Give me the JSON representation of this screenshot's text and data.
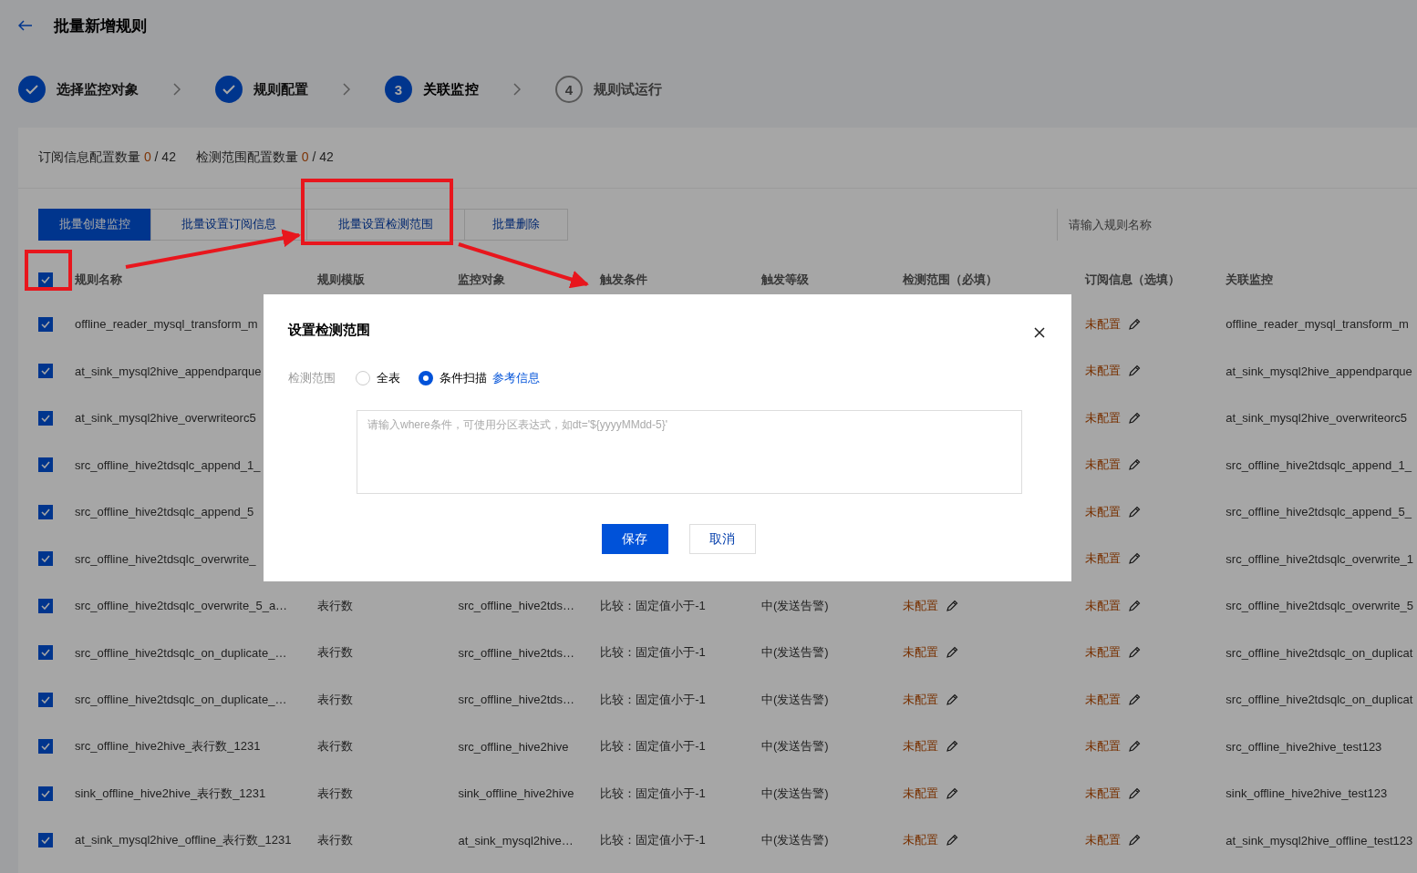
{
  "page": {
    "title": "批量新增规则"
  },
  "steps": [
    {
      "label": "选择监控对象",
      "completed": true,
      "selected": false
    },
    {
      "label": "规则配置",
      "completed": true,
      "selected": false
    },
    {
      "label": "关联监控",
      "completed": false,
      "selected": true,
      "number": "3"
    },
    {
      "label": "规则试运行",
      "completed": false,
      "selected": false,
      "number": "4"
    }
  ],
  "summary": [
    {
      "label": "订阅信息配置数量",
      "count": "0",
      "total": "/ 42"
    },
    {
      "label": "检测范围配置数量",
      "count": "0",
      "total": "/ 42"
    }
  ],
  "toolbar": {
    "buttons": [
      {
        "label": "批量创建监控",
        "kind": "primary"
      },
      {
        "label": "批量设置订阅信息",
        "kind": "default"
      },
      {
        "label": "批量设置检测范围",
        "kind": "default"
      },
      {
        "label": "批量删除",
        "kind": "default"
      }
    ],
    "search": {
      "placeholder": "请输入规则名称"
    }
  },
  "table": {
    "all_checked": true,
    "columns": [
      "规则名称",
      "规则模版",
      "监控对象",
      "触发条件",
      "触发等级",
      "检测范围（必填）",
      "订阅信息（选填）",
      "关联监控"
    ],
    "rows": [
      {
        "checked": true,
        "name": "offline_reader_mysql_transform_m",
        "subscription": "未配置",
        "linked": "offline_reader_mysql_transform_m"
      },
      {
        "checked": true,
        "name": "at_sink_mysql2hive_appendparque",
        "subscription": "未配置",
        "linked": "at_sink_mysql2hive_appendparque"
      },
      {
        "checked": true,
        "name": "at_sink_mysql2hive_overwriteorc5",
        "subscription": "未配置",
        "linked": "at_sink_mysql2hive_overwriteorc5"
      },
      {
        "checked": true,
        "name": "src_offline_hive2tdsqlc_append_1_",
        "subscription": "未配置",
        "linked": "src_offline_hive2tdsqlc_append_1_"
      },
      {
        "checked": true,
        "name": "src_offline_hive2tdsqlc_append_5",
        "subscription": "未配置",
        "linked": "src_offline_hive2tdsqlc_append_5_"
      },
      {
        "checked": true,
        "name": "src_offline_hive2tdsqlc_overwrite_",
        "subscription": "未配置",
        "linked": "src_offline_hive2tdsqlc_overwrite_1"
      },
      {
        "checked": true,
        "name": "src_offline_hive2tdsqlc_overwrite_5_a…",
        "template": "表行数",
        "object": "src_offline_hive2tds…",
        "condition": "比较：固定值小于-1",
        "level": "中(发送告警)",
        "range": "未配置",
        "subscription": "未配置",
        "linked": "src_offline_hive2tdsqlc_overwrite_5"
      },
      {
        "checked": true,
        "name": "src_offline_hive2tdsqlc_on_duplicate_…",
        "template": "表行数",
        "object": "src_offline_hive2tds…",
        "condition": "比较：固定值小于-1",
        "level": "中(发送告警)",
        "range": "未配置",
        "subscription": "未配置",
        "linked": "src_offline_hive2tdsqlc_on_duplicat"
      },
      {
        "checked": true,
        "name": "src_offline_hive2tdsqlc_on_duplicate_…",
        "template": "表行数",
        "object": "src_offline_hive2tds…",
        "condition": "比较：固定值小于-1",
        "level": "中(发送告警)",
        "range": "未配置",
        "subscription": "未配置",
        "linked": "src_offline_hive2tdsqlc_on_duplicat"
      },
      {
        "checked": true,
        "name": "src_offline_hive2hive_表行数_1231",
        "template": "表行数",
        "object": "src_offline_hive2hive",
        "condition": "比较：固定值小于-1",
        "level": "中(发送告警)",
        "range": "未配置",
        "subscription": "未配置",
        "linked": "src_offline_hive2hive_test123"
      },
      {
        "checked": true,
        "name": "sink_offline_hive2hive_表行数_1231",
        "template": "表行数",
        "object": "sink_offline_hive2hive",
        "condition": "比较：固定值小于-1",
        "level": "中(发送告警)",
        "range": "未配置",
        "subscription": "未配置",
        "linked": "sink_offline_hive2hive_test123"
      },
      {
        "checked": true,
        "name": "at_sink_mysql2hive_offline_表行数_1231",
        "template": "表行数",
        "object": "at_sink_mysql2hive…",
        "condition": "比较：固定值小于-1",
        "level": "中(发送告警)",
        "range": "未配置",
        "subscription": "未配置",
        "linked": "at_sink_mysql2hive_offline_test123"
      }
    ]
  },
  "dialog": {
    "title": "设置检测范围",
    "field_label": "检测范围",
    "options": [
      {
        "label": "全表",
        "selected": false
      },
      {
        "label": "条件扫描",
        "selected": true
      }
    ],
    "link": "参考信息",
    "textarea": {
      "placeholder": "请输入where条件，可使用分区表达式，如dt='${yyyyMMdd-5}'"
    },
    "buttons": [
      {
        "label": "保存",
        "kind": "primary"
      },
      {
        "label": "取消",
        "kind": "default"
      }
    ]
  }
}
